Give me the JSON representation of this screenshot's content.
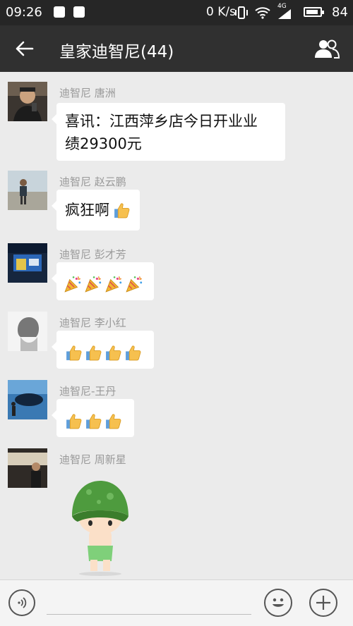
{
  "status_bar": {
    "time": "09:26",
    "network_speed": "0 K/s",
    "network_type": "4G",
    "battery": "84"
  },
  "header": {
    "title": "皇家迪智尼(44)",
    "back_icon": "back-arrow-icon",
    "members_icon": "group-members-icon"
  },
  "messages": [
    {
      "sender": "迪智尼 唐洲",
      "text_line1": "喜讯：江西萍乡店今日开业业",
      "text_line2": "绩29300元"
    },
    {
      "sender": "迪智尼 赵云鹏",
      "text": "疯狂啊",
      "emoji": [
        "thumbs-up"
      ]
    },
    {
      "sender": "迪智尼 彭才芳",
      "emoji": [
        "party-popper",
        "party-popper",
        "party-popper",
        "party-popper"
      ]
    },
    {
      "sender": "迪智尼 李小红",
      "emoji": [
        "thumbs-up",
        "thumbs-up",
        "thumbs-up",
        "thumbs-up"
      ]
    },
    {
      "sender": "迪智尼-王丹",
      "emoji": [
        "thumbs-up",
        "thumbs-up",
        "thumbs-up"
      ]
    },
    {
      "sender": "迪智尼 周新星",
      "sticker": "green-helmet-cartoon-sticker"
    }
  ],
  "input_bar": {
    "voice_icon": "voice-icon",
    "emoji_icon": "emoji-icon",
    "plus_icon": "plus-icon"
  },
  "colors": {
    "status_bar_bg": "#262626",
    "title_bar_bg": "#303030",
    "chat_bg": "#ebebeb",
    "bubble_bg": "#ffffff",
    "sender_text": "#999999"
  }
}
